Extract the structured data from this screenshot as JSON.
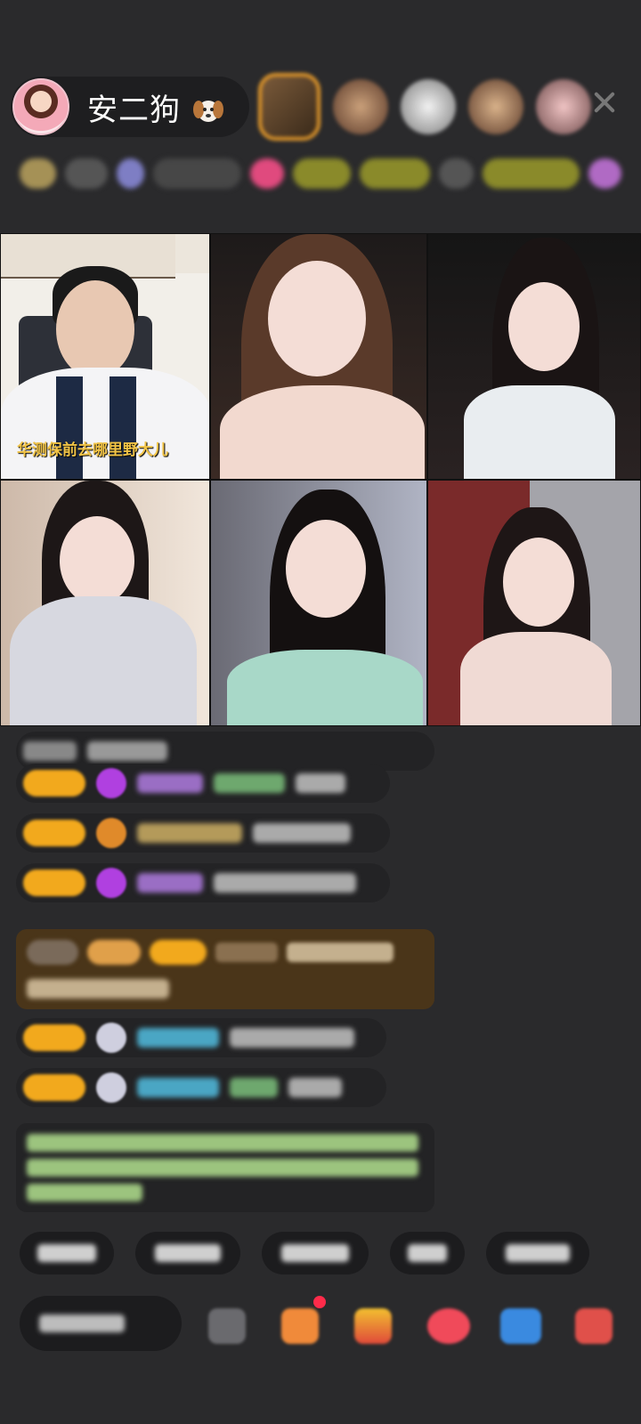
{
  "header": {
    "host_name": "安二狗",
    "host_icon": "dog-emoji-icon",
    "viewer_avatars": [
      "viewer-avatar-1",
      "viewer-avatar-2",
      "viewer-avatar-3",
      "viewer-avatar-4",
      "viewer-avatar-5"
    ],
    "close_icon": "close-icon"
  },
  "video_grid": {
    "tiles": [
      {
        "caption": "华测保前去哪里野大儿"
      },
      {
        "caption": ""
      },
      {
        "caption": ""
      },
      {
        "caption": ""
      },
      {
        "caption": ""
      },
      {
        "caption": ""
      }
    ]
  },
  "colors": {
    "background": "#2a2a2c",
    "pill": "#1e1e20",
    "badge_gold": "#f2a91d",
    "caption_yellow": "#f2c446",
    "special_row": "#4a3519"
  }
}
